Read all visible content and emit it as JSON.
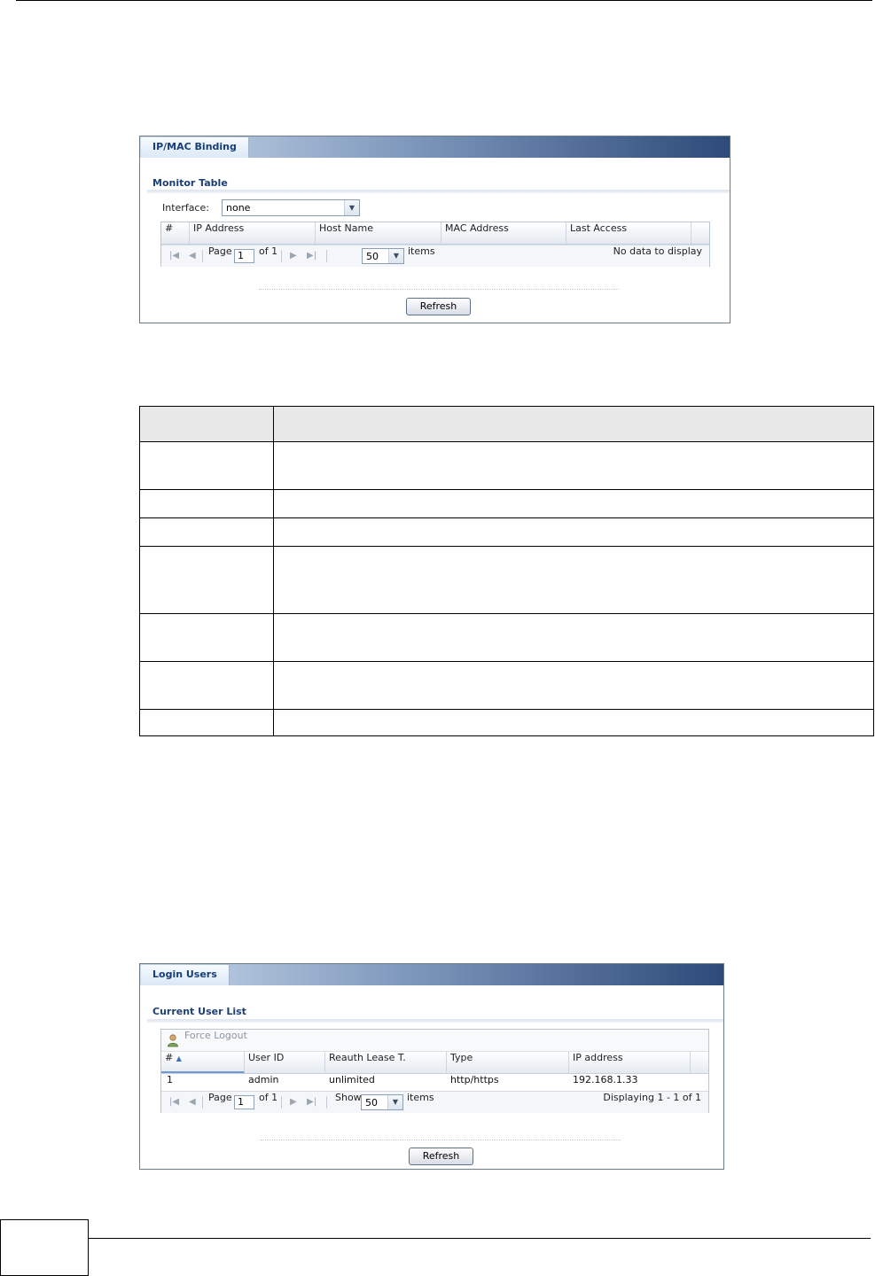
{
  "ipmac_panel": {
    "tab_label": "IP/MAC Binding",
    "section_title": "Monitor Table",
    "interface_label": "Interface:",
    "interface_value": "none",
    "columns": [
      "#",
      "IP Address",
      "Host Name",
      "MAC Address",
      "Last Access"
    ],
    "pager": {
      "page_label": "Page",
      "page_value": "1",
      "of_label": "of 1",
      "per_page_value": "50",
      "items_label": "items",
      "status": "No data to display"
    },
    "refresh_label": "Refresh"
  },
  "login_panel": {
    "tab_label": "Login Users",
    "section_title": "Current User List",
    "force_logout_label": "Force Logout",
    "columns": [
      "#",
      "User ID",
      "Reauth Lease T.",
      "Type",
      "IP address"
    ],
    "rows": [
      {
        "num": "1",
        "user_id": "admin",
        "lease": "unlimited",
        "type": "http/https",
        "ip": "192.168.1.33"
      }
    ],
    "pager": {
      "page_label": "Page",
      "page_value": "1",
      "of_label": "of 1",
      "show_label": "Show",
      "per_page_value": "50",
      "items_label": "items",
      "status": "Displaying 1 - 1 of 1"
    },
    "refresh_label": "Refresh"
  },
  "colors": {
    "tab_text": "#173e78",
    "tab_gradient_end": "#2d4a79",
    "header_gray": "#e8e8e8"
  }
}
